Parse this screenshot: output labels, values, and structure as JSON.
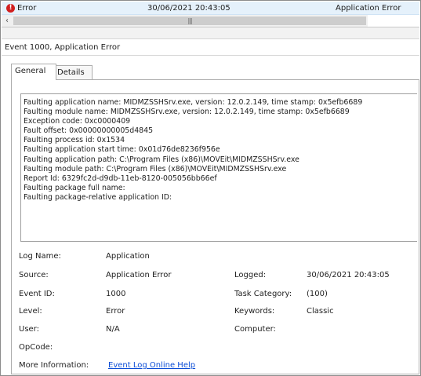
{
  "event_row": {
    "level": "Error",
    "date_time": "30/06/2021 20:43:05",
    "source": "Application Error"
  },
  "event_header": "Event 1000, Application Error",
  "tabs": [
    "General",
    "Details"
  ],
  "description_lines": [
    "Faulting application name: MIDMZSSHSrv.exe, version: 12.0.2.149, time stamp: 0x5efb6689",
    "Faulting module name: MIDMZSSHSrv.exe, version: 12.0.2.149, time stamp: 0x5efb6689",
    "Exception code: 0xc0000409",
    "Fault offset: 0x00000000005d4845",
    "Faulting process id: 0x1534",
    "Faulting application start time: 0x01d76de8236f956e",
    "Faulting application path: C:\\Program Files (x86)\\MOVEit\\MIDMZSSHSrv.exe",
    "Faulting module path: C:\\Program Files (x86)\\MOVEit\\MIDMZSSHSrv.exe",
    "Report Id: 6329fc2d-d9db-11eb-8120-005056bb66ef",
    "Faulting package full name:",
    "Faulting package-relative application ID:"
  ],
  "properties": {
    "log_name": {
      "label": "Log Name:",
      "value": "Application"
    },
    "source": {
      "label": "Source:",
      "value": "Application Error"
    },
    "event_id": {
      "label": "Event ID:",
      "value": "1000"
    },
    "level": {
      "label": "Level:",
      "value": "Error"
    },
    "user": {
      "label": "User:",
      "value": "N/A"
    },
    "opcode": {
      "label": "OpCode:",
      "value": ""
    },
    "more_info": {
      "label": "More Information:",
      "value": "Event Log Online Help"
    },
    "logged": {
      "label": "Logged:",
      "value": "30/06/2021 20:43:05"
    },
    "task_category": {
      "label": "Task Category:",
      "value": "(100)"
    },
    "keywords": {
      "label": "Keywords:",
      "value": "Classic"
    },
    "computer": {
      "label": "Computer:",
      "value": ""
    }
  },
  "icons": {
    "error": "error-circle-icon",
    "scroll_left": "chevron-left-icon",
    "grip": "grip-icon"
  },
  "colors": {
    "selected_row": "#e5f1fb",
    "error": "#d11f1f",
    "link": "#0a4cd6"
  }
}
